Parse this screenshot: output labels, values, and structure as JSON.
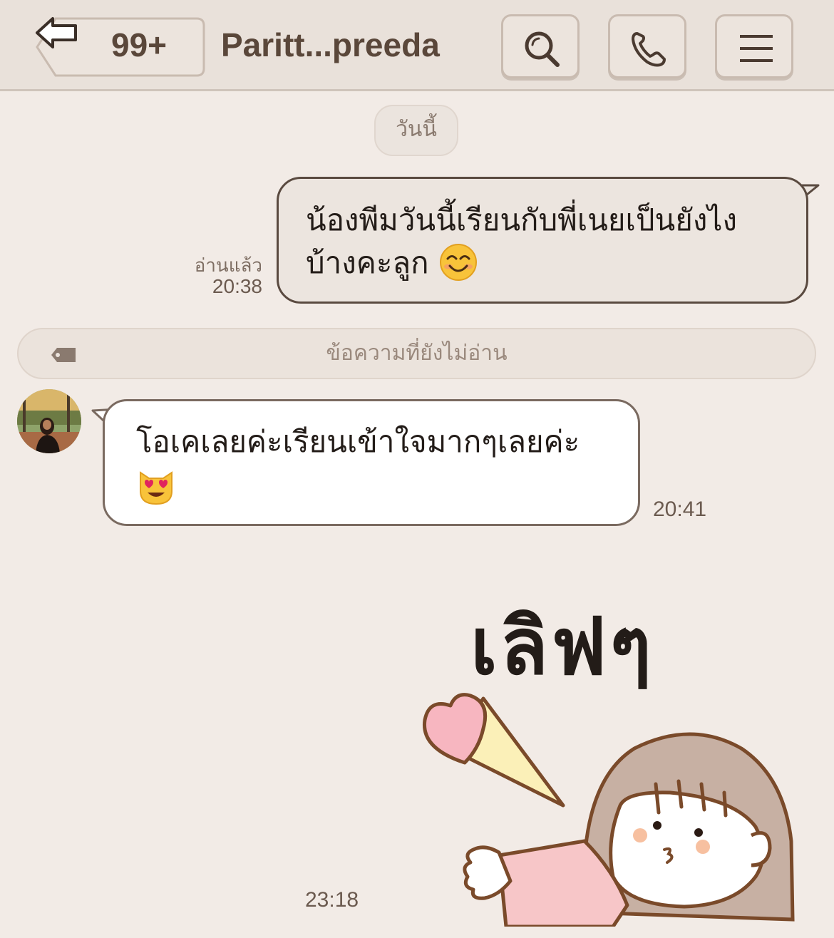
{
  "header": {
    "back_count": "99+",
    "title": "Paritt...preeda"
  },
  "date_separator": "วันนี้",
  "messages": [
    {
      "direction": "sent",
      "text": "น้องพีมวันนี้เรียนกับพี่เนยเป็นยังไงบ้างคะลูก",
      "emoji": "smiling-face-icon",
      "read_status": "อ่านแล้ว",
      "time": "20:38"
    },
    {
      "direction": "received",
      "text": "โอเคเลยค่ะเรียนเข้าใจมากๆเลยค่ะ",
      "emoji": "heart-eyes-cat-icon",
      "time": "20:41"
    },
    {
      "direction": "received",
      "type": "sticker",
      "sticker_text": "เลิฟๆ",
      "time": "23:18"
    }
  ],
  "unread_divider": "ข้อความที่ยังไม่อ่าน",
  "colors": {
    "background": "#f2ebe6",
    "header": "#e9e1da",
    "accent": "#5a473a"
  }
}
